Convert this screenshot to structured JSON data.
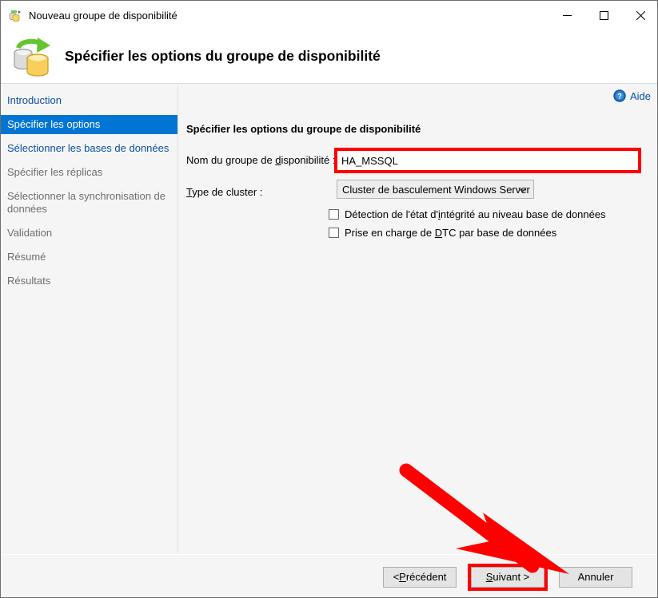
{
  "window": {
    "title": "Nouveau groupe de disponibilité",
    "icon": "availability-group-icon",
    "controls": {
      "minimize": "minimize-icon",
      "maximize": "maximize-icon",
      "close": "close-icon"
    }
  },
  "header": {
    "title": "Spécifier les options du groupe de disponibilité",
    "icon": "database-replication-icon"
  },
  "sidebar": {
    "items": [
      {
        "label": "Introduction",
        "state": "link"
      },
      {
        "label": "Spécifier les options",
        "state": "selected"
      },
      {
        "label": "Sélectionner les bases de données",
        "state": "link"
      },
      {
        "label": "Spécifier les réplicas",
        "state": "disabled"
      },
      {
        "label": "Sélectionner la synchronisation de données",
        "state": "disabled"
      },
      {
        "label": "Validation",
        "state": "disabled"
      },
      {
        "label": "Résumé",
        "state": "disabled"
      },
      {
        "label": "Résultats",
        "state": "disabled"
      }
    ]
  },
  "content": {
    "help": {
      "label": "Aide",
      "icon": "help-circle-icon"
    },
    "section_title": "Spécifier les options du groupe de disponibilité",
    "name_field": {
      "label_before": "Nom du groupe de ",
      "label_mnemonic": "d",
      "label_after": "isponibilité :",
      "value": "HA_MSSQL"
    },
    "cluster_field": {
      "label_mnemonic": "T",
      "label_after": "ype de cluster :",
      "selected": "Cluster de basculement Windows Server",
      "chevron": "chevron-down-icon"
    },
    "checkboxes": [
      {
        "before": "Détection de l'état d'",
        "mnemonic": "i",
        "after": "ntégrité au niveau base de données",
        "checked": false
      },
      {
        "before": "Prise en charge de ",
        "mnemonic": "D",
        "after": "TC par base de données",
        "checked": false
      }
    ]
  },
  "footer": {
    "previous": {
      "before": "< ",
      "mnemonic": "P",
      "after": "récédent"
    },
    "next": {
      "mnemonic": "S",
      "after": "uivant >"
    },
    "cancel": {
      "label": "Annuler"
    }
  },
  "annotations": {
    "arrow_color": "#fe0000",
    "highlight_color": "#fe0000",
    "accent_color": "#0075d4",
    "link_color": "#0a50a1"
  }
}
